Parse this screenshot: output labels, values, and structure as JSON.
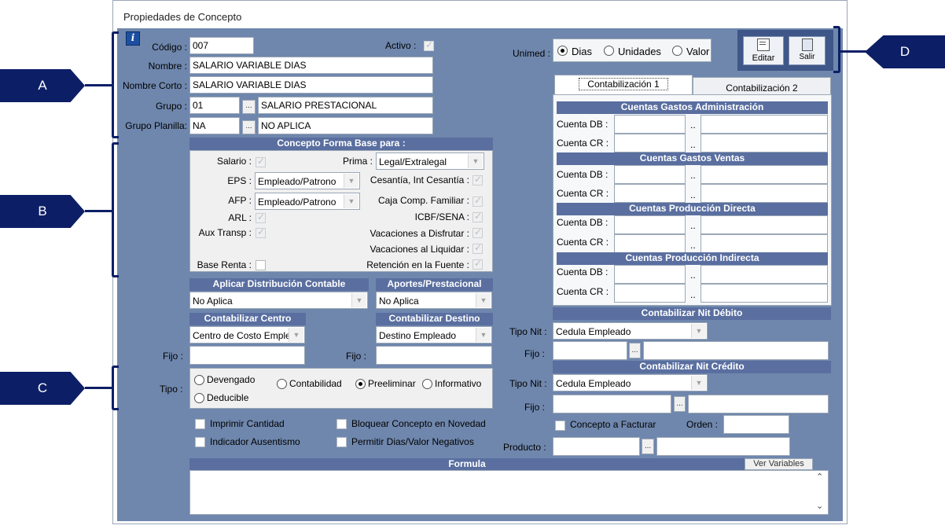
{
  "window": {
    "title": "Propiedades de Concepto"
  },
  "markers": {
    "a": "A",
    "b": "B",
    "c": "C",
    "d": "D"
  },
  "header": {
    "codigo_label": "Código :",
    "codigo_value": "007",
    "activo_label": "Activo :",
    "nombre_label": "Nombre :",
    "nombre_value": "SALARIO VARIABLE DIAS",
    "nombre_corto_label": "Nombre Corto :",
    "nombre_corto_value": "SALARIO VARIABLE DIAS",
    "grupo_label": "Grupo :",
    "grupo_code": "01",
    "grupo_desc": "SALARIO PRESTACIONAL",
    "grupo_planilla_label": "Grupo Planilla:",
    "grupo_planilla_code": "NA",
    "grupo_planilla_desc": "NO APLICA",
    "browse": "...",
    "info_icon": "i"
  },
  "base_form": {
    "title": "Concepto Forma Base para :",
    "salario_label": "Salario :",
    "prima_label": "Prima :",
    "prima_value": "Legal/Extralegal",
    "eps_label": "EPS :",
    "eps_value": "Empleado/Patrono",
    "cesantia_label": "Cesantía, Int Cesantía :",
    "afp_label": "AFP :",
    "afp_value": "Empleado/Patrono",
    "caja_label": "Caja Comp. Familiar :",
    "arl_label": "ARL :",
    "icbf_label": "ICBF/SENA :",
    "aux_label": "Aux Transp :",
    "vac_disfrutar_label": "Vacaciones a Disfrutar :",
    "vac_liquidar_label": "Vacaciones al Liquidar :",
    "base_renta_label": "Base Renta :",
    "retencion_label": "Retención en la Fuente :"
  },
  "distribucion": {
    "title": "Aplicar Distribución Contable",
    "value": "No Aplica"
  },
  "aportes": {
    "title": "Aportes/Prestacional",
    "value": "No Aplica"
  },
  "centro": {
    "title": "Contabilizar Centro",
    "value": "Centro de Costo Emple",
    "fijo_label": "Fijo :"
  },
  "destino": {
    "title": "Contabilizar Destino",
    "value": "Destino Empleado",
    "fijo_label": "Fijo :"
  },
  "tipo": {
    "label": "Tipo :",
    "options": [
      "Devengado",
      "Deducible",
      "Contabilidad",
      "Preeliminar",
      "Informativo"
    ],
    "selected": "Preeliminar"
  },
  "checks": {
    "imprimir": "Imprimir Cantidad",
    "ausentismo": "Indicador Ausentismo",
    "bloquear": "Bloquear Concepto en Novedad",
    "negativos": "Permitir Dias/Valor Negativos"
  },
  "formula": {
    "title": "Formula",
    "ver_variables": "Ver Variables"
  },
  "unimed": {
    "label": "Unimed :",
    "options": [
      "Dias",
      "Unidades",
      "Valor"
    ],
    "selected": "Dias"
  },
  "toolbar": {
    "editar": "Editar",
    "salir": "Salir"
  },
  "tabs": [
    "Contabilización 1",
    "Contabilización 2"
  ],
  "cuentas": {
    "db_label": "Cuenta DB :",
    "cr_label": "Cuenta CR :",
    "dots": "..",
    "sections": [
      "Cuentas Gastos Administración",
      "Cuentas Gastos Ventas",
      "Cuentas Producción Directa",
      "Cuentas Producción Indirecta"
    ]
  },
  "nit_debito": {
    "title": "Contabilizar Nit Débito",
    "tipo_label": "Tipo Nit :",
    "tipo_value": "Cedula Empleado",
    "fijo_label": "Fijo :"
  },
  "nit_credito": {
    "title": "Contabilizar Nit Crédito",
    "tipo_label": "Tipo Nit :",
    "tipo_value": "Cedula Empleado",
    "fijo_label": "Fijo :"
  },
  "facturar": {
    "label": "Concepto a Facturar",
    "orden_label": "Orden :",
    "producto_label": "Producto :"
  },
  "colors": {
    "client_bg": "#6f87ad",
    "header_bg": "#5a6fa0",
    "marker": "#0c1f66"
  }
}
